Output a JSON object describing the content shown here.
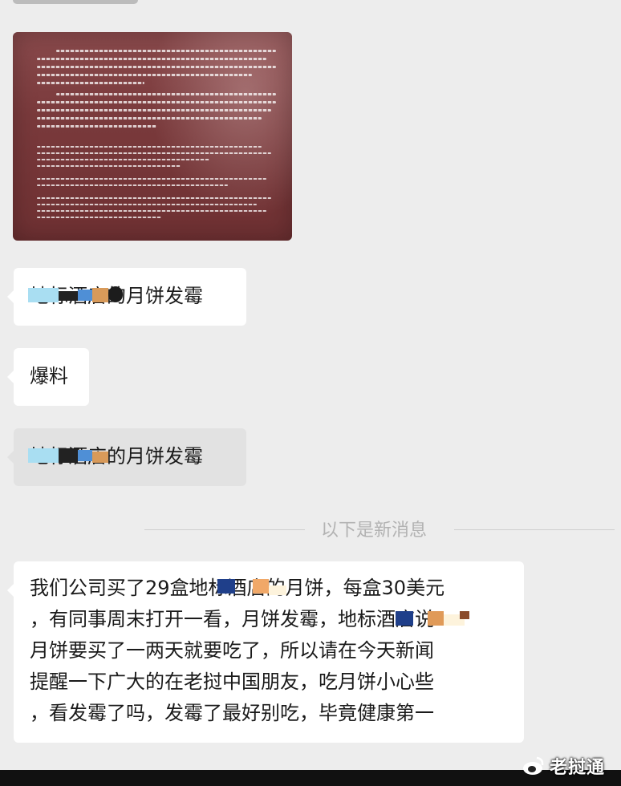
{
  "messages": [
    {
      "text": "地标酒店的月饼发霉"
    },
    {
      "text": "爆料"
    },
    {
      "text": "地标酒店的月饼发霉"
    }
  ],
  "divider": {
    "label": "以下是新消息"
  },
  "last_message": {
    "lines": [
      "我们公司买了29盒地标酒店的月饼，每盒30美元",
      "，有同事周末打开一看，月饼发霉，地标酒店说",
      "月饼要买了一两天就要吃了，所以请在今天新闻",
      "提醒一下广大的在老挝中国朋友，吃月饼小心些",
      "，看发霉了吗，发霉了最好别吃，毕竟健康第一"
    ]
  },
  "watermark": {
    "text": "老挝通",
    "icon": "weibo-style-logo-icon"
  },
  "colors": {
    "background": "#ededed",
    "bubble": "#ffffff",
    "bubble_selected": "#e2e2e2",
    "divider_text": "#b2b2b2",
    "photo": "#7a3a3c"
  }
}
